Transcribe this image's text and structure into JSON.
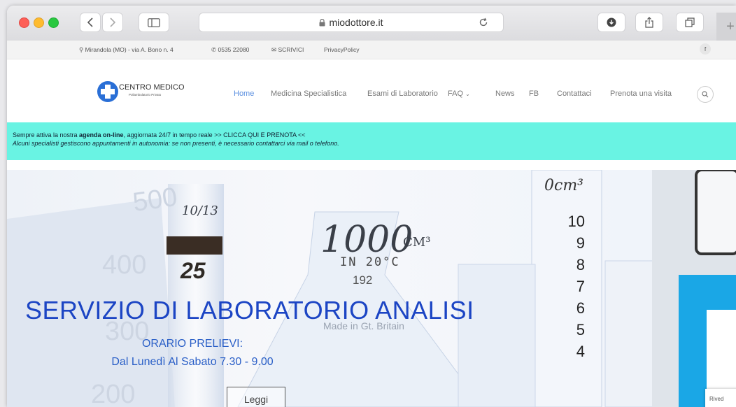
{
  "browser": {
    "url": "miodottore.it",
    "lock_icon": "lock-icon"
  },
  "topbar": {
    "address": "Mirandola (MO) - via A. Bono n. 4",
    "phone": "0535 22080",
    "write": "SCRIVICI",
    "privacy": "PrivacyPolicy",
    "social": "f"
  },
  "header": {
    "logo_title": "CENTRO MEDICO",
    "logo_sub": "Poliambulatorio Privato",
    "nav": [
      "Home",
      "Medicina Specialistica",
      "Esami di Laboratorio",
      "FAQ",
      "News",
      "FB",
      "Contattaci",
      "Prenota una visita"
    ]
  },
  "notice": {
    "line1_a": "Sempre attiva la nostra ",
    "line1_b": "agenda on-line",
    "line1_c": ", aggiornata 24/7 in tempo reale >> ",
    "line1_d": "CLICCA QUI E PRENOTA <<",
    "line2": "Alcuni specialisti gestiscono appuntamenti in autonomia: se non presenti, è necessario contattarci via mail o telefono."
  },
  "hero": {
    "title": "SERVIZIO DI LABORATORIO ANALISI",
    "subtitle": "ORARIO PRELIEVI:",
    "hours": "Dal Lunedì Al Sabato 7.30 - 9.00",
    "button": "Leggi",
    "bg_text": {
      "big": "1000",
      "unit": "CM³",
      "temp": "IN 20°C",
      "label1": "10/13",
      "label2": "25",
      "label3": "0cm³",
      "made": "Made in Gt. Britain",
      "n92": "192",
      "t500": "500",
      "t400": "400",
      "t300": "300",
      "t200": "200",
      "scale": [
        "10",
        "9",
        "8",
        "7",
        "6",
        "5",
        "4"
      ]
    },
    "side_tag": "Rived"
  },
  "colors": {
    "accent": "#2a5fc7",
    "notice_bg": "#69f3e3",
    "title_blue": "#1c45c4"
  }
}
